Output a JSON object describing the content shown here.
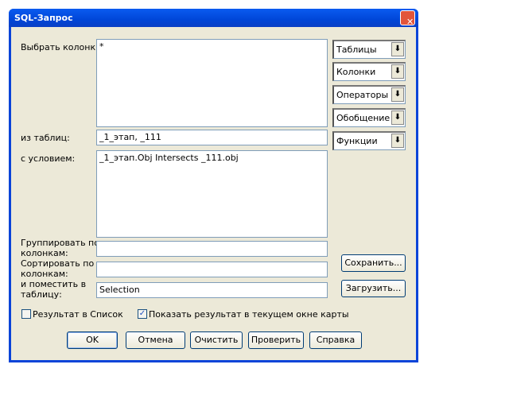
{
  "title": "SQL-Запрос",
  "labels": {
    "select": "Выбрать колонки:",
    "from": "из таблиц:",
    "where": "с условием:",
    "group1": "Группировать по",
    "group2": "колонкам:",
    "order1": "Сортировать по",
    "order2": "колонкам:",
    "into1": "и поместить в",
    "into2": "таблицу:"
  },
  "values": {
    "select": "*",
    "from": "_1_этап, _111",
    "where": "_1_этап.Obj Intersects _111.obj",
    "group": "",
    "order": "",
    "into": "Selection"
  },
  "dropdowns": [
    "Таблицы",
    "Колонки",
    "Операторы",
    "Обобщение",
    "Функции"
  ],
  "side_buttons": {
    "save": "Сохранить...",
    "load": "Загрузить..."
  },
  "checkboxes": [
    {
      "label": "Результат в Список",
      "checked": false
    },
    {
      "label": "Показать результат в текущем окне карты",
      "checked": true
    }
  ],
  "buttons": {
    "ok": "OK",
    "cancel": "Отмена",
    "clear": "Очистить",
    "verify": "Проверить",
    "help": "Справка"
  },
  "icons": {
    "close": "✕",
    "dropdown": "⬇",
    "check": "✓"
  }
}
